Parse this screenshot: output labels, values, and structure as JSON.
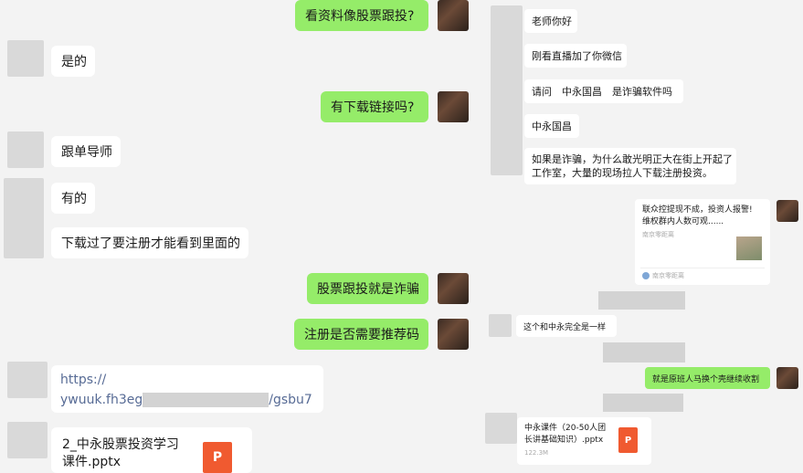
{
  "left_chat": {
    "messages": [
      {
        "side": "right",
        "text": "看资料像股票跟投?"
      },
      {
        "side": "left",
        "text": "是的"
      },
      {
        "side": "right",
        "text": "有下载链接吗?"
      },
      {
        "side": "left",
        "text": "跟单导师"
      },
      {
        "side": "left",
        "text": "有的"
      },
      {
        "side": "left",
        "text": "下载过了要注册才能看到里面的"
      },
      {
        "side": "right",
        "text": "股票跟投就是诈骗"
      },
      {
        "side": "right",
        "text": "注册是否需要推荐码"
      }
    ],
    "link": {
      "line1": "https://",
      "line2_prefix": "ywuuk.fh3eg",
      "line2_suffix": "/gsbu7"
    },
    "file": {
      "name_line1": "2_中永股票投资学习",
      "name_line2": "课件.pptx",
      "icon_letter": "P"
    }
  },
  "right_chat": {
    "messages": [
      "老师你好",
      "刚看直播加了你微信",
      "请问　中永国昌　是诈骗软件吗",
      "中永国昌",
      "如果是诈骗，为什么敢光明正大在街上开起了",
      "工作室，大量的现场拉人下载注册投资。"
    ],
    "news_card": {
      "title_line1": "联众控提现不成，投资人报警!",
      "title_line2": "维权群内人数可观......",
      "source1": "南京零距离",
      "source2": "南京零距离"
    },
    "reply": "这个和中永完全是一样",
    "my_reply": "就是原班人马换个壳继续收割",
    "file": {
      "name_line1": "中永课件（20-50人团",
      "name_line2": "长讲基础知识）.pptx",
      "size": "122.3M",
      "icon_letter": "P"
    }
  },
  "colors": {
    "green_bubble": "#95ec69",
    "background": "#f3f3f3",
    "link": "#576b95",
    "ppt": "#f05a30"
  }
}
